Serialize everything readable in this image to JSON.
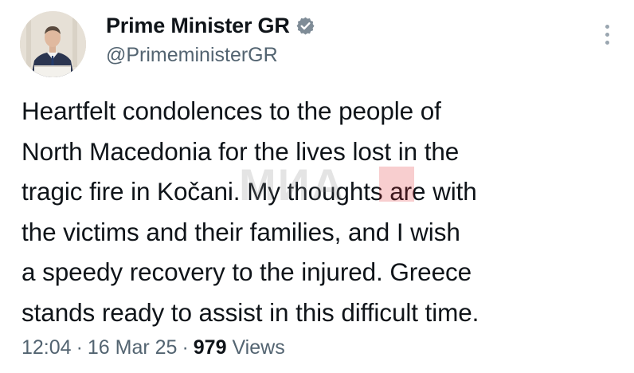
{
  "author": {
    "display_name": "Prime Minister GR",
    "handle": "@PrimeministerGR",
    "verified_icon": "verified-badge-icon",
    "avatar_icon": "profile-photo"
  },
  "tweet": {
    "text_lines": [
      "Heartfelt condolences to the people of",
      "North Macedonia for the lives lost in the",
      "tragic fire in Kočani. My thoughts are with",
      "the victims and their families, and I wish",
      "a speedy recovery to the injured. Greece",
      "stands ready to assist in this difficult time."
    ]
  },
  "watermark": {
    "text": "МИА",
    "accent": "#e2232a"
  },
  "meta": {
    "time": "12:04",
    "separator": "·",
    "date": "16 Mar 25",
    "views_count": "979",
    "views_label": "Views"
  },
  "colors": {
    "text": "#0f1419",
    "secondary": "#536471",
    "verified": "#7f8c97"
  }
}
